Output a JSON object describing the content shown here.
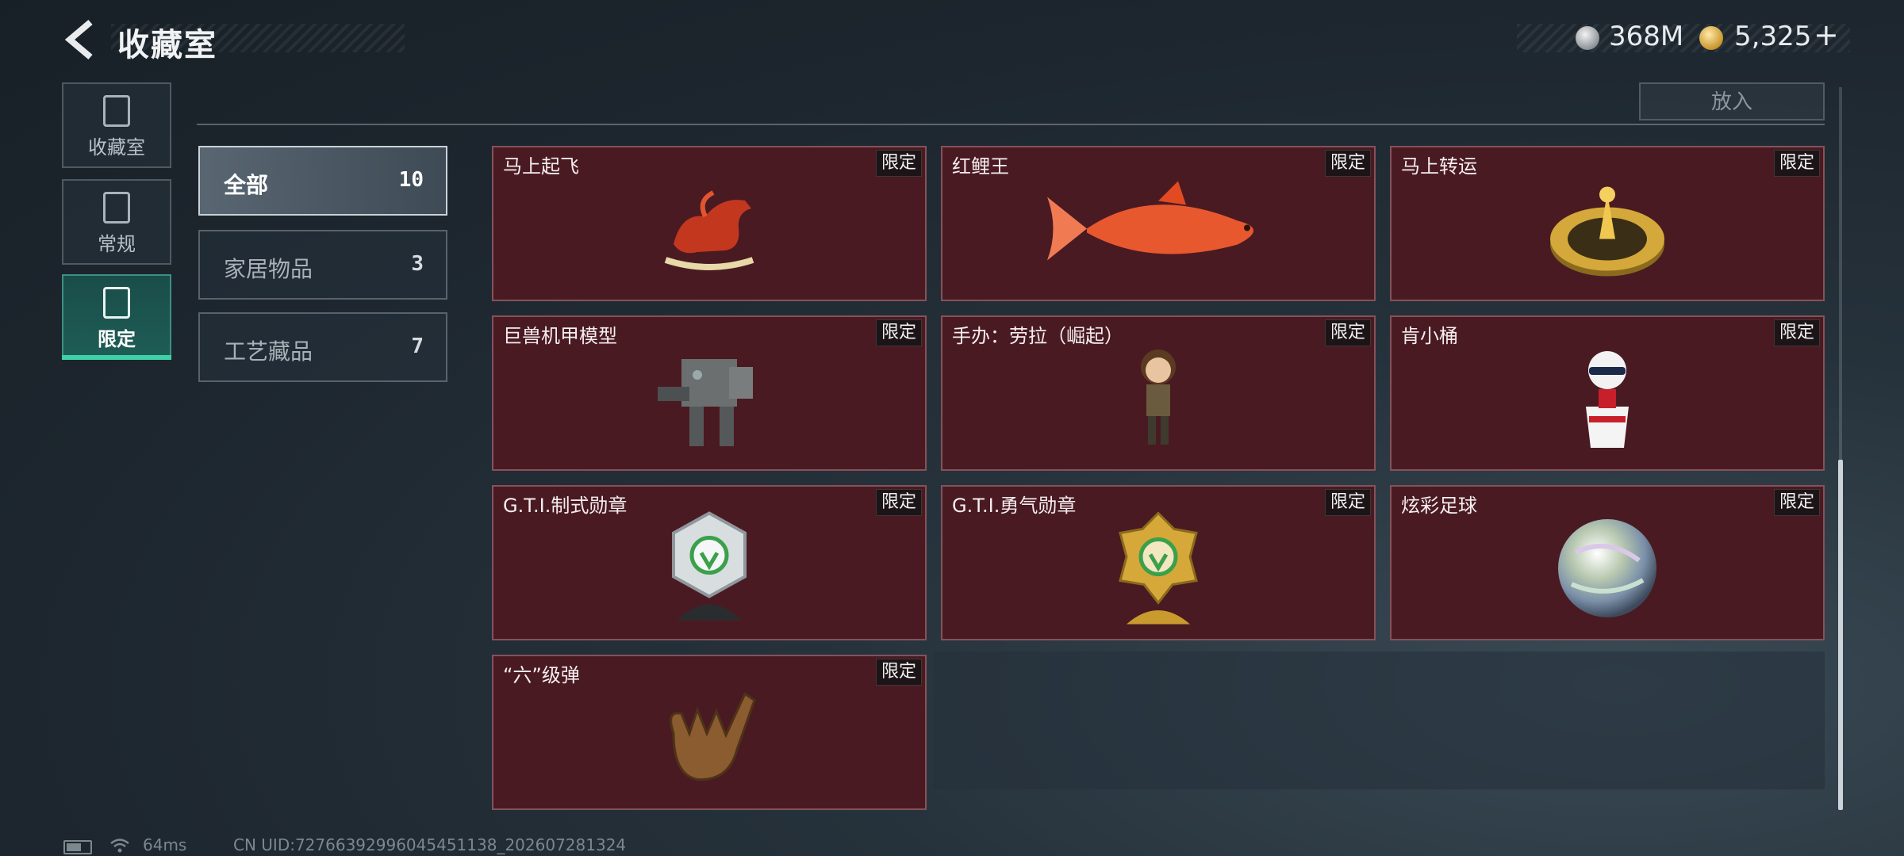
{
  "header": {
    "title": "收藏室",
    "silver_amount": "368M",
    "gold_amount": "5,325",
    "gold_plus": "+"
  },
  "section": {
    "title": "",
    "put_button": "放入"
  },
  "nav": [
    {
      "label": "收藏室",
      "icon": "collection-icon"
    },
    {
      "label": "常规",
      "icon": "regular-icon"
    },
    {
      "label": "限定",
      "icon": "limited-icon",
      "active": true
    }
  ],
  "filters": [
    {
      "label": "全部",
      "count": "10",
      "active": true
    },
    {
      "label": "家居物品",
      "count": "3"
    },
    {
      "label": "工艺藏品",
      "count": "7"
    }
  ],
  "items": [
    {
      "name": "马上起飞",
      "badge": "限定",
      "icon": "horse-rocking-icon"
    },
    {
      "name": "红鲤王",
      "badge": "限定",
      "icon": "red-carp-icon"
    },
    {
      "name": "马上转运",
      "badge": "限定",
      "icon": "golden-wheel-icon"
    },
    {
      "name": "巨兽机甲模型",
      "badge": "限定",
      "icon": "mech-model-icon"
    },
    {
      "name": "手办：劳拉（崛起）",
      "badge": "限定",
      "icon": "lara-figure-icon"
    },
    {
      "name": "肯小桶",
      "badge": "限定",
      "icon": "kfc-bucket-figure-icon"
    },
    {
      "name": "G.T.I.制式勋章",
      "badge": "限定",
      "icon": "silver-medal-icon"
    },
    {
      "name": "G.T.I.勇气勋章",
      "badge": "限定",
      "icon": "gold-medal-icon"
    },
    {
      "name": "炫彩足球",
      "badge": "限定",
      "icon": "iridescent-ball-icon"
    },
    {
      "name": "“六”级弹",
      "badge": "限定",
      "icon": "shaka-hand-icon"
    }
  ],
  "footer": {
    "ping": "64ms",
    "uid": "CN UID:72766392996045451138_202607281324"
  },
  "colors": {
    "card_bg": "#4a1a22",
    "active_nav": "#1f5d56",
    "accent_green": "#3fd1a6"
  }
}
